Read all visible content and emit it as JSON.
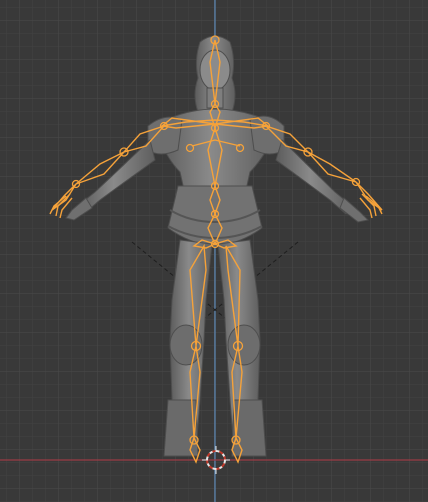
{
  "viewport": {
    "background": "#393939",
    "grid_minor_color": "#414141",
    "grid_major_color": "#4a4a4a",
    "axis_x_color": "#9b3c46",
    "axis_z_color": "#5b87b5",
    "armature_color": "#f5a23a",
    "mesh_color": "#7b7b7b"
  },
  "objects": {
    "character_mesh": "character-mesh",
    "armature": "armature-pose",
    "cursor": "3d-cursor"
  }
}
